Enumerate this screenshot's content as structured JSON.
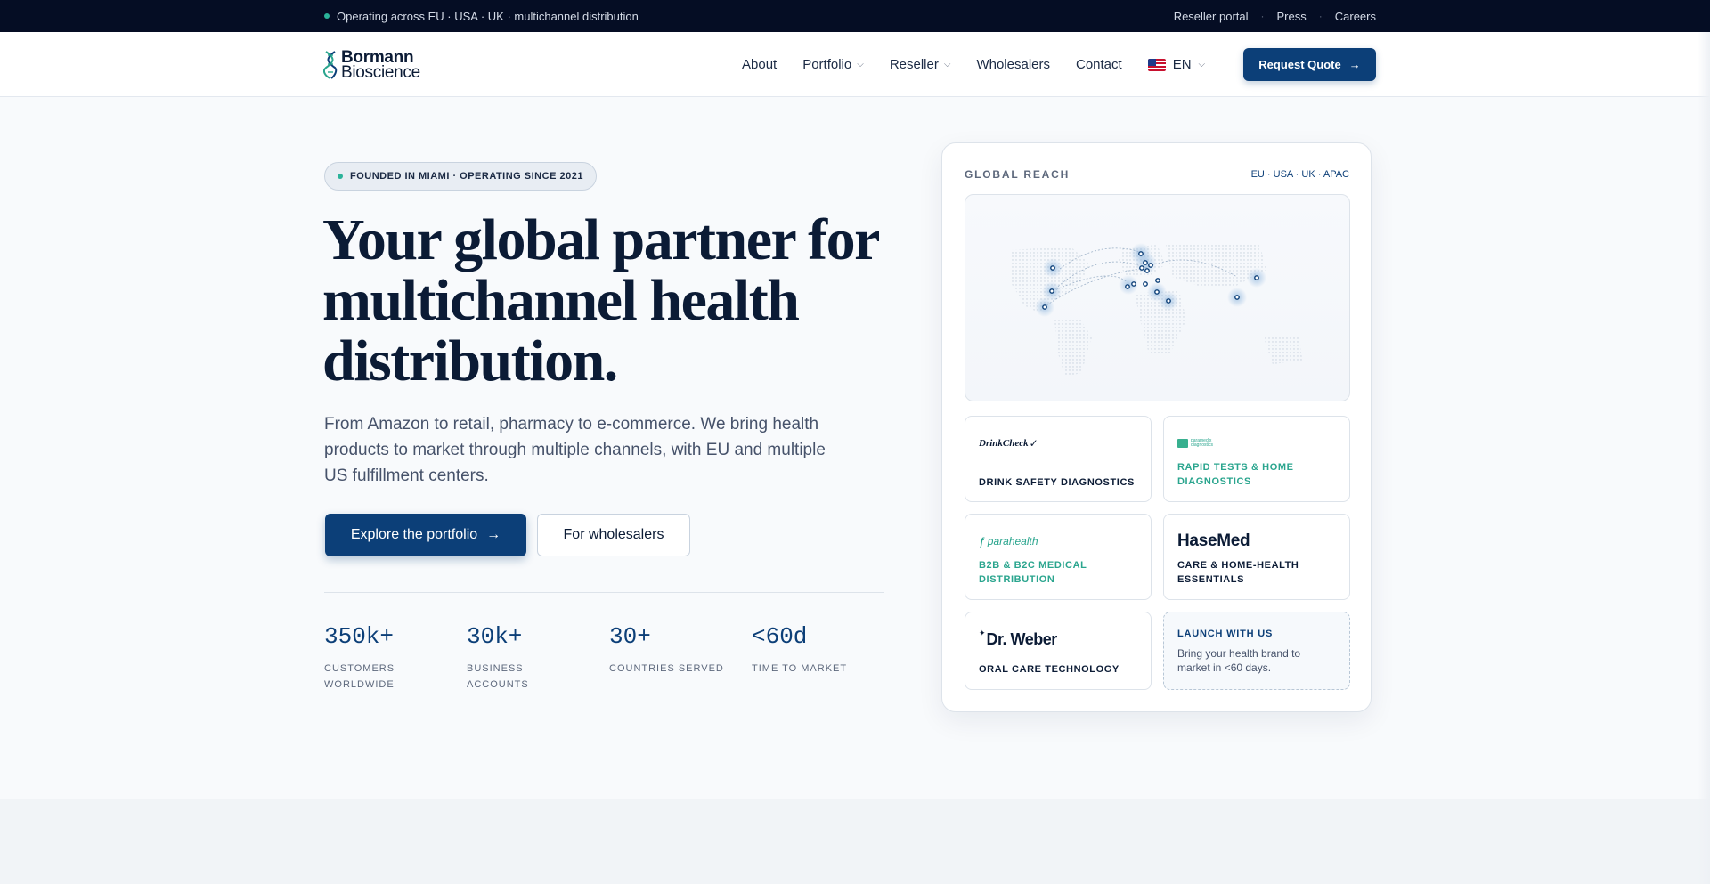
{
  "topbar": {
    "announcement": "Operating across EU · USA · UK · multichannel distribution",
    "links": [
      "Reseller portal",
      "Press",
      "Careers"
    ],
    "separator": "·"
  },
  "header": {
    "logo": {
      "line1": "Bormann",
      "line2": "Bioscience"
    },
    "nav": {
      "about": "About",
      "portfolio": "Portfolio",
      "reseller": "Reseller",
      "wholesalers": "Wholesalers",
      "contact": "Contact",
      "language": "EN"
    },
    "cta": "Request Quote",
    "cta_arrow": "→",
    "chevron": "⌄"
  },
  "hero": {
    "badge": "FOUNDED IN MIAMI · OPERATING SINCE 2021",
    "headline": "Your global partner for multichannel health distribution.",
    "lede": "From Amazon to retail, pharmacy to e-commerce. We bring health products to market through multiple channels, with EU and multiple US fulfillment centers.",
    "primary_button": "Explore the portfolio",
    "primary_arrow": "→",
    "secondary_button": "For wholesalers",
    "stats": [
      {
        "value": "350k+",
        "label": "CUSTOMERS WORLDWIDE"
      },
      {
        "value": "30k+",
        "label": "BUSINESS ACCOUNTS"
      },
      {
        "value": "30+",
        "label": "COUNTRIES SERVED"
      },
      {
        "value": "<60d",
        "label": "TIME TO MARKET"
      }
    ]
  },
  "reach_card": {
    "title": "GLOBAL REACH",
    "regions": "EU · USA · UK · APAC",
    "brands": [
      {
        "logo_text": "DrinkCheck",
        "caption": "DRINK SAFETY DIAGNOSTICS"
      },
      {
        "logo_text": "paramedix diagnostics",
        "caption": "RAPID TESTS & HOME DIAGNOSTICS"
      },
      {
        "logo_text": "parahealth",
        "caption": "B2B & B2C MEDICAL DISTRIBUTION"
      },
      {
        "logo_text": "HaseMed",
        "caption": "CARE & HOME-HEALTH ESSENTIALS"
      },
      {
        "logo_text": "Dr. Weber",
        "caption": "ORAL CARE TECHNOLOGY"
      }
    ],
    "launch": {
      "title": "LAUNCH WITH US",
      "text": "Bring your health brand to market in <60 days."
    }
  },
  "colors": {
    "navy": "#0c3f78",
    "ink": "#0b1b35",
    "teal": "#2aa58e",
    "topbar": "#050d24"
  }
}
